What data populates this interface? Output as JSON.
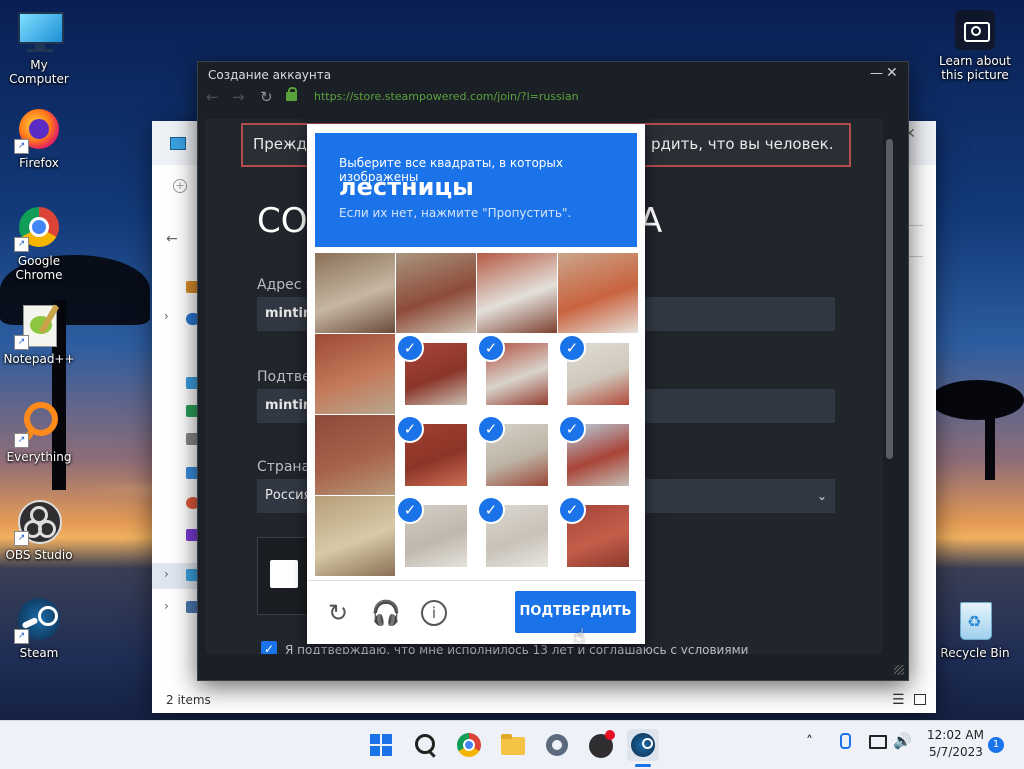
{
  "desktop": {
    "icons": [
      {
        "label": "My Computer",
        "icon": "monitor-icon"
      },
      {
        "label": "Firefox",
        "icon": "firefox-icon"
      },
      {
        "label": "Google Chrome",
        "icon": "chrome-icon"
      },
      {
        "label": "Notepad++",
        "icon": "notepadpp-icon"
      },
      {
        "label": "Everything",
        "icon": "search-magnifier-icon"
      },
      {
        "label": "OBS Studio",
        "icon": "obs-icon"
      },
      {
        "label": "Steam",
        "icon": "steam-icon"
      }
    ],
    "learn_about": "Learn about this picture",
    "recycle_bin": "Recycle Bin"
  },
  "explorer": {
    "status": "2 items"
  },
  "steam_window": {
    "title": "Создание аккаунта",
    "url": "https://store.steampowered.com/join/?l=russian",
    "notice_left": "Прежде",
    "notice_right": "рдить, что вы человек.",
    "heading_left": "СО",
    "heading_right": "А",
    "email_label": "Адрес э",
    "email_value": "mintim",
    "confirm_label": "Подтвер",
    "confirm_value": "mintim",
    "country_label": "Страна",
    "country_value": "Россия",
    "agree_text": "Я подтверждаю, что мне исполнилось 13 лет и соглашаюсь с условиями"
  },
  "captcha": {
    "instruction": "Выберите все квадраты, в которых изображены",
    "target": "лестницы",
    "hint": "Если их нет, нажмите \"Пропустить\".",
    "verify_label": "ПОДТВЕРДИТЬ",
    "tiles": [
      {
        "selected": false
      },
      {
        "selected": false
      },
      {
        "selected": false
      },
      {
        "selected": false
      },
      {
        "selected": false
      },
      {
        "selected": true
      },
      {
        "selected": true
      },
      {
        "selected": true
      },
      {
        "selected": false
      },
      {
        "selected": true
      },
      {
        "selected": true
      },
      {
        "selected": true
      },
      {
        "selected": false
      },
      {
        "selected": true
      },
      {
        "selected": true
      },
      {
        "selected": true
      }
    ]
  },
  "taskbar": {
    "time": "12:02 AM",
    "date": "5/7/2023",
    "notification_count": "1"
  },
  "colors": {
    "captcha_blue": "#1a73e8",
    "steam_dark": "#1b1f26",
    "url_green": "#5aa23b"
  }
}
